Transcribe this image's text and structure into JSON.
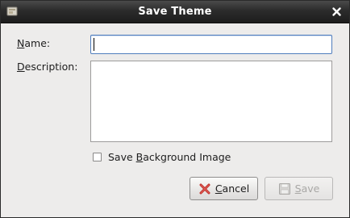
{
  "window": {
    "title": "Save Theme"
  },
  "form": {
    "name_label": "Name:",
    "name_value": "",
    "description_label": "Description:",
    "description_value": "",
    "save_background_label": "Save Background Image",
    "save_background_checked": false
  },
  "buttons": {
    "cancel_label": "Cancel",
    "save_label": "Save",
    "save_enabled": false
  },
  "icons": {
    "app": "theme-icon",
    "close": "close-icon",
    "cancel": "cancel-x-icon",
    "save": "floppy-disk-icon"
  },
  "colors": {
    "titlebar": "#2b2b2b",
    "background": "#edeceb",
    "focus_border": "#4f7dbd",
    "cancel_icon": "#c0302a"
  }
}
